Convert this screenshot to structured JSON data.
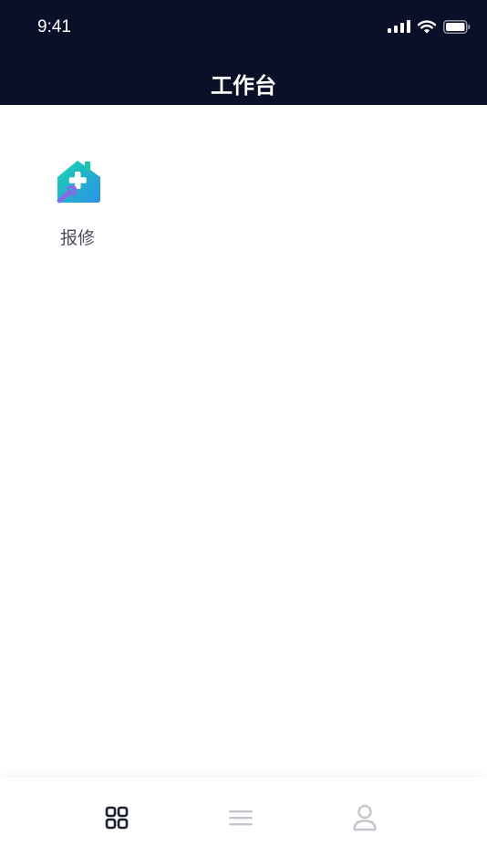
{
  "status_bar": {
    "time": "9:41"
  },
  "nav": {
    "title": "工作台"
  },
  "workbench": {
    "items": [
      {
        "label": "报修",
        "icon": "house-repair-icon"
      }
    ]
  },
  "tab_bar": {
    "tabs": [
      {
        "icon": "grid-icon",
        "active": true
      },
      {
        "icon": "menu-lines-icon",
        "active": false
      },
      {
        "icon": "user-icon",
        "active": false
      }
    ]
  },
  "colors": {
    "header_bg": "#0b1029",
    "active_tab": "#1c2033",
    "inactive_tab": "#c4c6cd",
    "label_text": "#4a4d5c",
    "icon_teal": "#19d2b4",
    "icon_blue": "#2f8fe8",
    "icon_purple": "#8a63e8"
  }
}
